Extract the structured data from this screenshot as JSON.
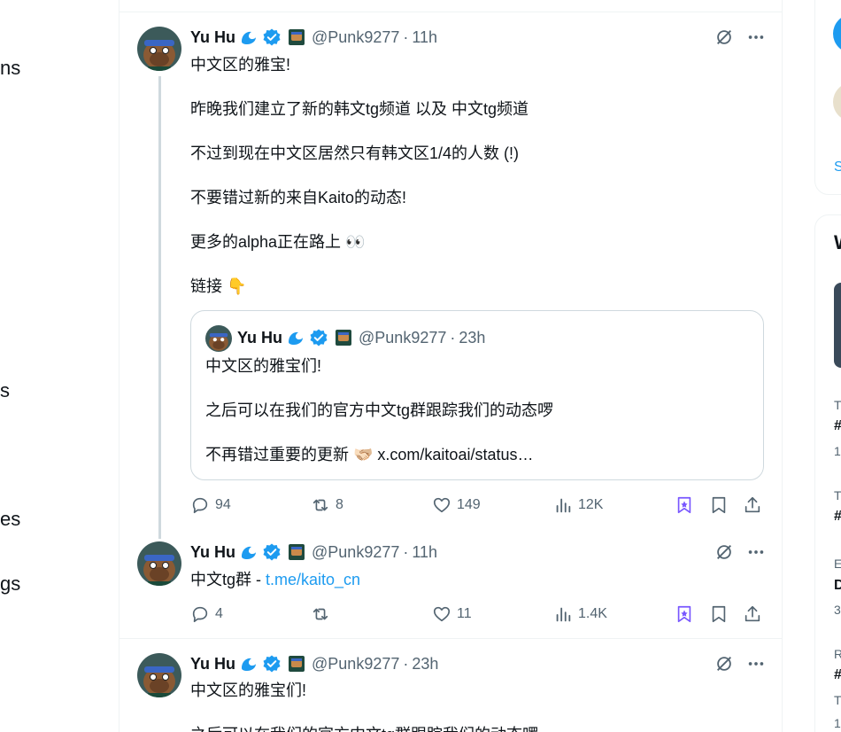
{
  "left_nav": {
    "fragments": [
      "ns",
      "s",
      "es",
      "gs"
    ]
  },
  "colors": {
    "accent": "#1d9bf0",
    "text": "#0f1419",
    "muted": "#536471",
    "border": "#cfd9de",
    "grok_purple": "#7856ff",
    "like_red": "#f91880"
  },
  "tweets": [
    {
      "display_name": "Yu Hu",
      "handle": "@Punk9277",
      "sep": "·",
      "time": "11h",
      "lines": [
        "中文区的雅宝!",
        "昨晚我们建立了新的韩文tg频道 以及 中文tg频道",
        "不过到现在中文区居然只有韩文区1/4的人数 (!)",
        "不要错过新的来自Kaito的动态!",
        "更多的alpha正在路上 👀",
        "链接 👇"
      ],
      "quote": {
        "display_name": "Yu Hu",
        "handle": "@Punk9277",
        "sep": "·",
        "time": "23h",
        "lines": [
          "中文区的雅宝们!",
          "之后可以在我们的官方中文tg群跟踪我们的动态啰",
          "不再错过重要的更新 🫱🏻‍🫲🏼 x.com/kaitoai/status…"
        ]
      },
      "stats": {
        "replies": "94",
        "reposts": "8",
        "likes": "149",
        "views": "12K"
      }
    },
    {
      "display_name": "Yu Hu",
      "handle": "@Punk9277",
      "sep": "·",
      "time": "11h",
      "text_prefix": "中文tg群 - ",
      "link": "t.me/kaito_cn",
      "stats": {
        "replies": "4",
        "reposts": "",
        "likes": "11",
        "views": "1.4K"
      }
    },
    {
      "display_name": "Yu Hu",
      "handle": "@Punk9277",
      "sep": "·",
      "time": "23h",
      "lines": [
        "中文区的雅宝们!",
        "之后可以在我们的官方中文tg群跟踪我们的动态啰"
      ]
    }
  ],
  "right_column": {
    "fragments": [
      "S",
      "W",
      "T",
      "#",
      "1",
      "T",
      "#",
      "E",
      "D",
      "3",
      "R",
      "#",
      "T",
      "1"
    ]
  },
  "icons": {
    "verified": "verified-badge-icon",
    "wave": "wave-emoji-icon",
    "flag": "affiliate-flag-icon",
    "grok": "grok-icon",
    "more": "more-icon",
    "reply": "reply-icon",
    "repost": "repost-icon",
    "like": "like-icon",
    "views": "views-icon",
    "grok_bookmark": "grok-bookmark-icon",
    "bookmark": "bookmark-icon",
    "share": "share-icon"
  }
}
